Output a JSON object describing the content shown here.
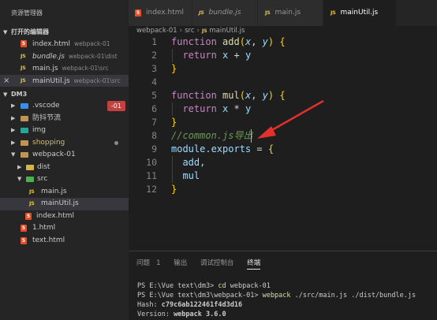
{
  "sidebar": {
    "title": "资源管理器",
    "open_editors": {
      "header": "打开的编辑器",
      "items": [
        {
          "name": "index.html",
          "desc": "webpack-01"
        },
        {
          "name": "bundle.js",
          "desc": "webpack-01\\dist"
        },
        {
          "name": "main.js",
          "desc": "webpack-01\\src"
        },
        {
          "name": "mainUtil.js",
          "desc": "webpack-01\\src"
        }
      ]
    },
    "workspace": {
      "header": "DM3",
      "vscode": ".vscode",
      "vscode_badge": "-01",
      "prevention": "防抖节流",
      "img": "img",
      "shopping": "shopping",
      "webpack": "webpack-01",
      "dist": "dist",
      "src": "src",
      "main_js": "main.js",
      "mainutil_js": "mainUtil.js",
      "index_html": "index.html",
      "one_html": "1.html",
      "text_html": "text.html"
    }
  },
  "tabs": [
    {
      "label": "index.html"
    },
    {
      "label": "bundle.js"
    },
    {
      "label": "main.js"
    },
    {
      "label": "mainUtil.js"
    }
  ],
  "breadcrumb": {
    "a": "webpack-01",
    "b": "src",
    "c": "mainUtil.js"
  },
  "code": {
    "line_numbers": [
      "1",
      "2",
      "3",
      "4",
      "5",
      "6",
      "7",
      "8",
      "9",
      "10",
      "11",
      "12"
    ],
    "kw_function": "function",
    "fn_add": "add",
    "fn_mul": "mul",
    "param_x": "x",
    "param_y": "y",
    "kw_return": "return",
    "comment": "//common.js导出",
    "module": "module",
    "exports": ".exports",
    "exp_add": "add,",
    "exp_mul": "mul"
  },
  "panel": {
    "tabs": {
      "problems": "问题",
      "problems_count": "1",
      "output": "输出",
      "debug": "调试控制台",
      "terminal": "终端"
    },
    "terminal": {
      "line1_prefix": "PS E:\\Vue text\\dm3> ",
      "line1_cmd": "cd",
      "line1_arg": " webpack-01",
      "line2_prefix": "PS E:\\Vue text\\dm3\\webpack-01> ",
      "line2_cmd": "webpack",
      "line2_arg": " ./src/main.js ./dist/bundle.js",
      "line3_label": "Hash: ",
      "line3_value": "c79c6ab122461f4d3d16",
      "line4_label": "Version: ",
      "line4_value": "webpack 3.6.0"
    }
  },
  "colors": {
    "accent_red": "#c24141",
    "arrow": "#e0312d"
  }
}
